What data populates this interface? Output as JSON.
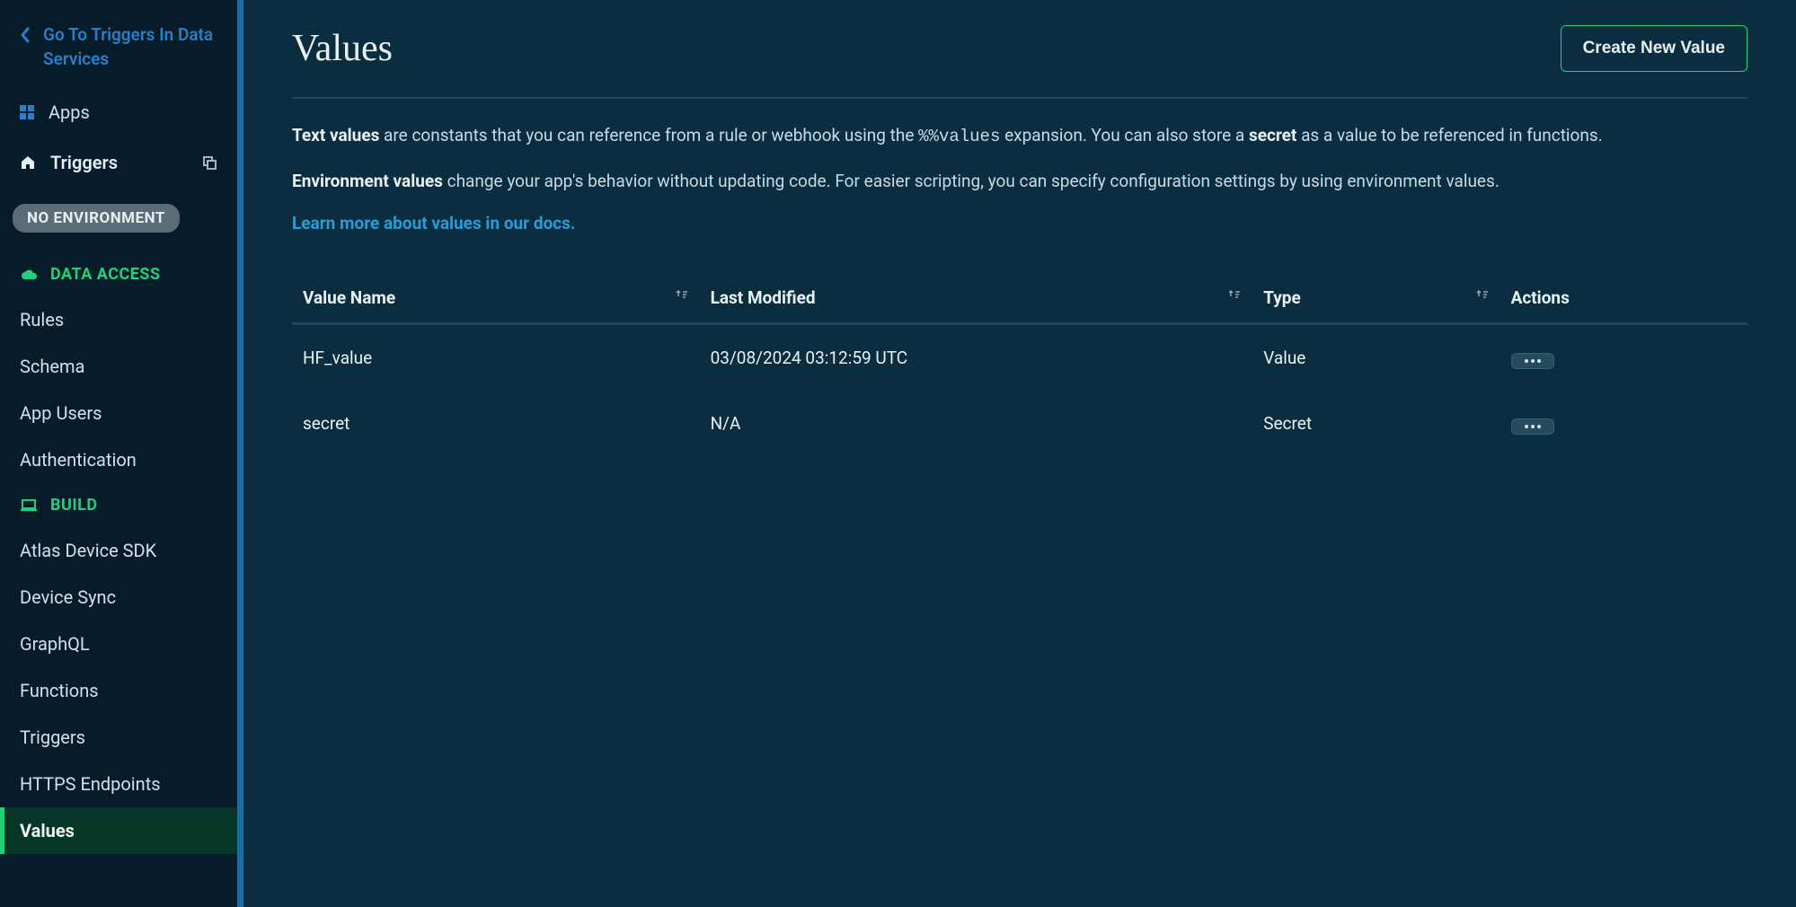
{
  "sidebar": {
    "back_link": "Go To Triggers In Data Services",
    "apps_label": "Apps",
    "triggers_label": "Triggers",
    "env_badge": "NO ENVIRONMENT",
    "sections": [
      {
        "title": "DATA ACCESS",
        "items": [
          "Rules",
          "Schema",
          "App Users",
          "Authentication"
        ]
      },
      {
        "title": "BUILD",
        "items": [
          "Atlas Device SDK",
          "Device Sync",
          "GraphQL",
          "Functions",
          "Triggers",
          "HTTPS Endpoints",
          "Values"
        ]
      }
    ],
    "active_item": "Values"
  },
  "header": {
    "title": "Values",
    "create_button": "Create New Value"
  },
  "description": {
    "text_values_label": "Text values",
    "text_values_rest": " are constants that you can reference from a rule or webhook using the ",
    "code": "%%values",
    "text_values_rest2": " expansion. You can also store a ",
    "secret_label": "secret",
    "text_values_rest3": " as a value to be referenced in functions.",
    "env_label": "Environment values",
    "env_rest": " change your app's behavior without updating code. For easier scripting, you can specify configuration settings by using environment values.",
    "learn_more": "Learn more about values in our docs."
  },
  "table": {
    "columns": [
      "Value Name",
      "Last Modified",
      "Type",
      "Actions"
    ],
    "rows": [
      {
        "name": "HF_value",
        "modified": "03/08/2024 03:12:59 UTC",
        "type": "Value"
      },
      {
        "name": "secret",
        "modified": "N/A",
        "type": "Secret"
      }
    ]
  }
}
